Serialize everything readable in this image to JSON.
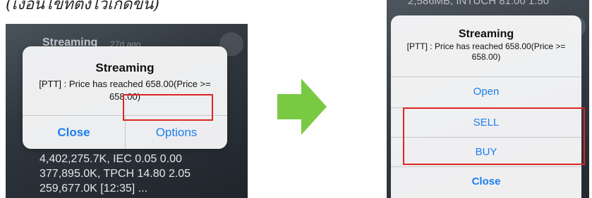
{
  "caption": "(เงื่อนไขที่ตั้งไว้เกิดขึ้น)",
  "left_screen": {
    "notification_title": "Streaming",
    "notification_age": "27d ago",
    "alert": {
      "title": "Streaming",
      "message": "[PTT] : Price has reached 658.00(Price >= 658.00)",
      "close_label": "Close",
      "options_label": "Options"
    },
    "background_lines": [
      "4,402,275.7K, IEC 0.05 0.00",
      "377,895.0K, TPCH 14.80 2.05",
      "259,677.0K [12:35] ..."
    ]
  },
  "right_screen": {
    "top_ticker": "2,586MB, INTUCH 81.00 1.50",
    "sheet": {
      "title": "Streaming",
      "message": "[PTT] : Price has reached 658.00(Price >= 658.00)",
      "open_label": "Open",
      "sell_label": "SELL",
      "buy_label": "BUY",
      "close_label": "Close"
    }
  },
  "colors": {
    "ios_blue": "#1a7ef0",
    "highlight_red": "#e02424",
    "arrow_green": "#7ac943"
  }
}
